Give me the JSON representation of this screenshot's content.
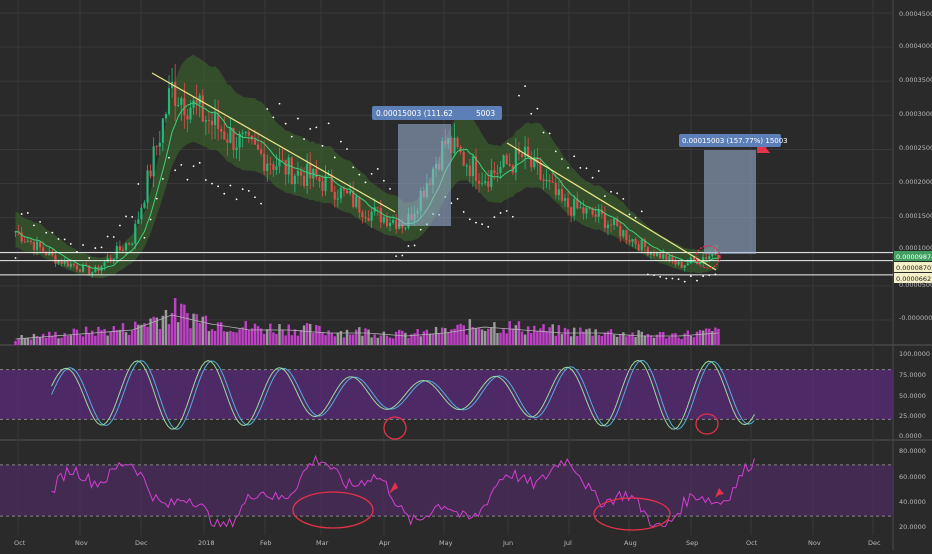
{
  "colors": {
    "background": "#2a2a2a",
    "grid": "#383838",
    "axis_text": "#b8b8b8",
    "candle_up": "#26b87a",
    "candle_down": "#e14b4b",
    "volume": "#c040c8",
    "volume_neutral": "#9a9a9a",
    "volume_ma": "#b0b0b0",
    "trendline": "#f0e88a",
    "support_line": "#f2f2f2",
    "parabolic_sar": "#ffffff",
    "ma_line": "#3fd07a",
    "band_fill": "#3d6b2c",
    "stoch_band": "#5a2a7a",
    "stoch_k": "#4fb0d8",
    "stoch_d": "#9fd8a0",
    "rsi_band": "#4a2a5a",
    "rsi_line": "#d23fd0",
    "annotation": "#e4324a",
    "measure_fill": "#9fb4d8",
    "measure_label": "#5c7fb8",
    "price_badge_green": "#3fa060",
    "price_badge_light": "#f4f0c8"
  },
  "chart_data": [
    {
      "type": "candlestick",
      "panel": "price",
      "x_labels": [
        "Oct",
        "Nov",
        "Dec",
        "2018",
        "Feb",
        "Mar",
        "Apr",
        "May",
        "Jun",
        "Jul",
        "Aug",
        "Sep",
        "Oct",
        "Nov",
        "Dec"
      ],
      "y_ticks": [
        "0.00045000",
        "0.00040000",
        "0.00035000",
        "0.00030000",
        "0.00025000",
        "0.00020000",
        "0.00015000",
        "0.00010000",
        "0.00005000",
        "-0.00000000"
      ],
      "ylim": [
        -2e-05,
        0.00046
      ],
      "close_approx": [
        0.00013,
        9e-05,
        7e-05,
        0.00012,
        0.00034,
        0.00029,
        0.00025,
        0.00022,
        0.0002,
        0.00016,
        0.00014,
        0.00026,
        0.00021,
        0.00024,
        0.00017,
        0.00015,
        0.00011,
        8e-05,
        0.0001
      ],
      "price_labels": [
        {
          "text": "0.00009874",
          "style": "green"
        },
        {
          "text": "0.00008707",
          "style": "light"
        },
        {
          "text": "0.00006621",
          "style": "light"
        }
      ],
      "horizontal_levels": [
        9.87e-05,
        8.71e-05,
        6.62e-05
      ],
      "measure_labels": [
        "0.00015003 (111.62",
        "5003",
        "0.00015003 (157.77%) 15003"
      ]
    },
    {
      "type": "bar",
      "panel": "volume",
      "values": [
        0.2,
        0.3,
        0.4,
        0.5,
        1.0,
        0.7,
        0.5,
        0.5,
        0.4,
        0.4,
        0.3,
        0.4,
        0.6,
        0.5,
        0.4,
        0.4,
        0.3,
        0.3,
        0.4
      ]
    },
    {
      "type": "line",
      "panel": "stochastic",
      "y_ticks": [
        "100.0000",
        "75.0000",
        "50.0000",
        "25.0000",
        "0.0000"
      ],
      "ylim": [
        0,
        100
      ],
      "band": [
        20,
        80
      ]
    },
    {
      "type": "line",
      "panel": "rsi",
      "y_ticks": [
        "80.0000",
        "60.0000",
        "40.0000",
        "20.0000"
      ],
      "ylim": [
        15,
        90
      ],
      "band": [
        30,
        70
      ]
    }
  ]
}
